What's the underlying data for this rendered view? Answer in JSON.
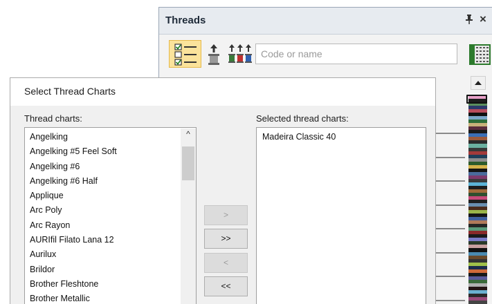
{
  "threads_panel": {
    "title": "Threads",
    "pin_glyph": "❡",
    "close_glyph": "×",
    "search": {
      "placeholder": "Code or name",
      "value": ""
    },
    "toolbar_icons": [
      "list-checkbox-icon",
      "single-spool-icon",
      "multi-spool-icon",
      "swatch-grid-icon"
    ],
    "strip_colors": [
      "#e8a0c8",
      "#1d1d1d",
      "#5b8f5e",
      "#2d3a6b",
      "#b84b5c",
      "#101010",
      "#7aa6c8",
      "#2e6e3a",
      "#c9b27a",
      "#5a2d3c",
      "#1a1a1a",
      "#3b6fb6",
      "#9c5a3b",
      "#2b2b2b",
      "#6bb0a0",
      "#383838",
      "#a33a3a",
      "#1f3f5a",
      "#8d8d8d",
      "#2c5b2c",
      "#d4b24a",
      "#141414",
      "#4a6b9c",
      "#7d3a6b",
      "#3a3a3a",
      "#5cb3d6",
      "#1e1e1e",
      "#a06a3a",
      "#2f4f2f",
      "#c74a7a",
      "#202020",
      "#6a8fb0",
      "#4c2c1c",
      "#9ab54a",
      "#161616",
      "#3f5fa0",
      "#b07a5a",
      "#262626",
      "#5a9a7a",
      "#8a2a2a",
      "#1b1b1b",
      "#7a7ac8",
      "#2a3a2a",
      "#c8a0a0",
      "#121212",
      "#4a8ab0",
      "#6a4a2a",
      "#333333",
      "#a0c04a",
      "#1c2c4c",
      "#d06a3a",
      "#181818",
      "#5a5a9a",
      "#3a6a3a",
      "#b0b0b0",
      "#241414",
      "#6ab0d0",
      "#2a2a2a",
      "#9a4a7a",
      "#444444"
    ]
  },
  "dialog": {
    "title": "Select Thread Charts",
    "available_label": "Thread charts:",
    "selected_label": "Selected thread charts:",
    "available_charts": [
      "Angelking",
      "Angelking #5 Feel Soft",
      "Angelking #6",
      "Angelking #6 Half",
      "Applique",
      "Arc Poly",
      "Arc Rayon",
      "AURIfil Filato Lana 12",
      "Aurilux",
      "Brildor",
      "Brother Fleshtone",
      "Brother Metallic"
    ],
    "selected_charts": [
      "Madeira Classic 40"
    ],
    "buttons": {
      "add": ">",
      "add_all": ">>",
      "remove": "<",
      "remove_all": "<<"
    },
    "button_states": {
      "add": "disabled",
      "add_all": "enabled",
      "remove": "disabled",
      "remove_all": "enabled"
    },
    "scroll_up_glyph": "^"
  }
}
